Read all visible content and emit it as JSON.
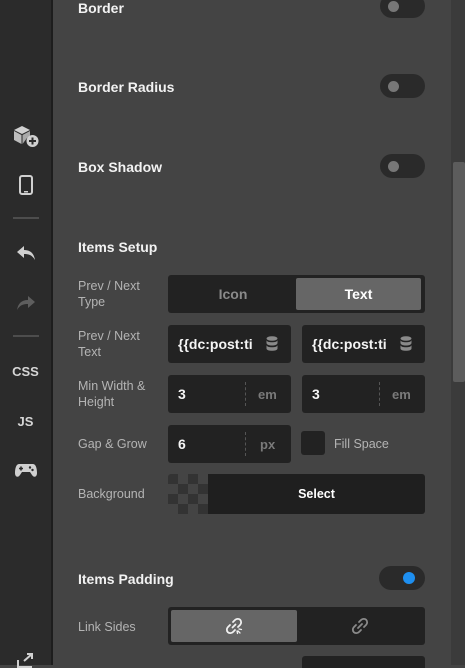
{
  "sidebar": {
    "css_label": "CSS",
    "js_label": "JS",
    "icons": [
      "add-element-icon",
      "device-icon",
      "undo-icon",
      "redo-icon",
      "gamepad-icon",
      "expand-icon"
    ]
  },
  "panel": {
    "border": {
      "label": "Border",
      "enabled": false
    },
    "border_radius": {
      "label": "Border Radius",
      "enabled": false
    },
    "box_shadow": {
      "label": "Box Shadow",
      "enabled": false
    },
    "items_setup": {
      "heading": "Items Setup",
      "prev_next_type": {
        "label": "Prev / Next Type",
        "options": [
          "Icon",
          "Text"
        ],
        "selected": "Text"
      },
      "prev_next_text": {
        "label": "Prev / Next Text",
        "prev_value": "{{dc:post:ti",
        "next_value": "{{dc:post:ti"
      },
      "min_width_height": {
        "label": "Min Width & Height",
        "width_value": "3",
        "width_unit": "em",
        "height_value": "3",
        "height_unit": "em"
      },
      "gap_grow": {
        "label": "Gap & Grow",
        "gap_value": "6",
        "gap_unit": "px",
        "fill_space_label": "Fill Space",
        "fill_space_checked": false
      },
      "background": {
        "label": "Background",
        "select_label": "Select"
      }
    },
    "items_padding": {
      "heading": "Items Padding",
      "enabled": true,
      "link_sides": {
        "label": "Link Sides",
        "options": [
          "link-icon",
          "unlink-icon"
        ],
        "selected": "link-icon"
      }
    }
  },
  "colors": {
    "toggle_on": "#1e8ff0",
    "panel_bg": "#444444",
    "sidebar_bg": "#2b2b2b"
  }
}
